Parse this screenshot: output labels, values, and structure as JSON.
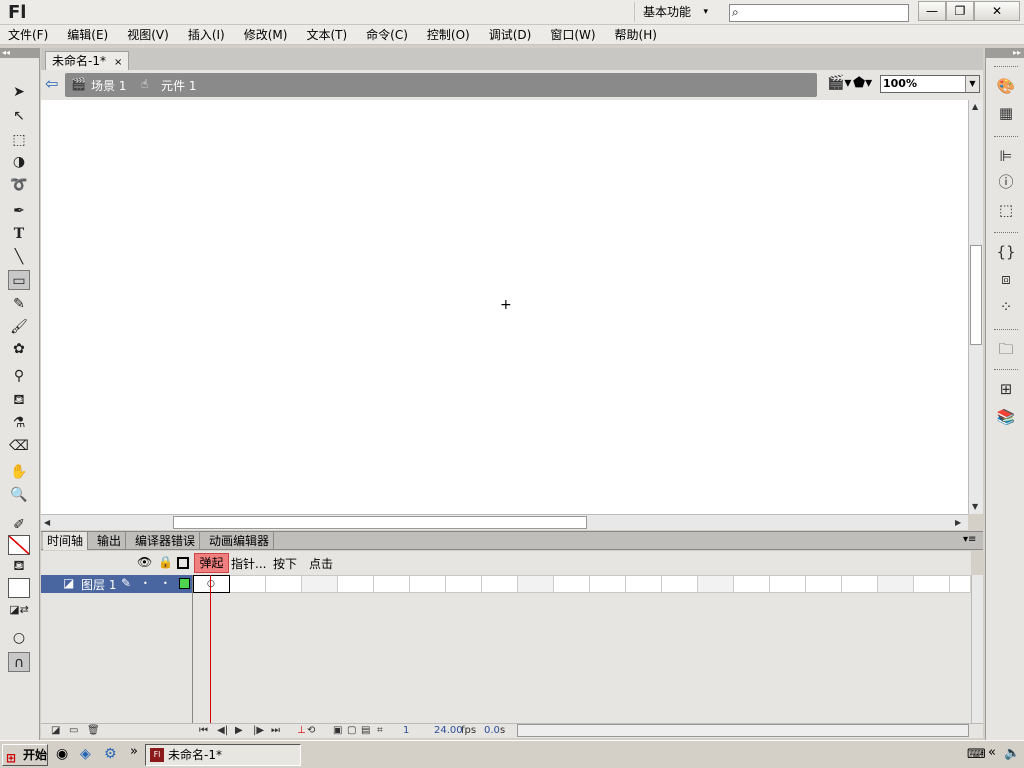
{
  "app": {
    "logo": "Fl",
    "workspace": "基本功能",
    "search_placeholder": ""
  },
  "window": {
    "minimize": "—",
    "restore": "❐",
    "close": "✕"
  },
  "menu": [
    "文件(F)",
    "编辑(E)",
    "视图(V)",
    "插入(I)",
    "修改(M)",
    "文本(T)",
    "命令(C)",
    "控制(O)",
    "调试(D)",
    "窗口(W)",
    "帮助(H)"
  ],
  "document": {
    "tab_title": "未命名-1*",
    "close_glyph": "×"
  },
  "breadcrumb": {
    "scene": "场景 1",
    "symbol": "元件 1"
  },
  "zoom": "100%",
  "panels": {
    "tabs": [
      "时间轴",
      "输出",
      "编译器错误",
      "动画编辑器"
    ]
  },
  "timeline": {
    "frame_labels": [
      "弹起",
      "指针...",
      "按下",
      "点击"
    ],
    "layer_name": "图层 1",
    "current_frame": "1",
    "fps": "24.00",
    "fps_unit": "fps",
    "time": "0.0",
    "time_unit": "s"
  },
  "taskbar": {
    "start": "开始",
    "task": "未命名-1*",
    "chevron": "»",
    "collapse": "«"
  },
  "colors": {
    "layer_selected": "#4a66a0",
    "playhead": "#d00000",
    "frame_label_active": "#f08080"
  }
}
